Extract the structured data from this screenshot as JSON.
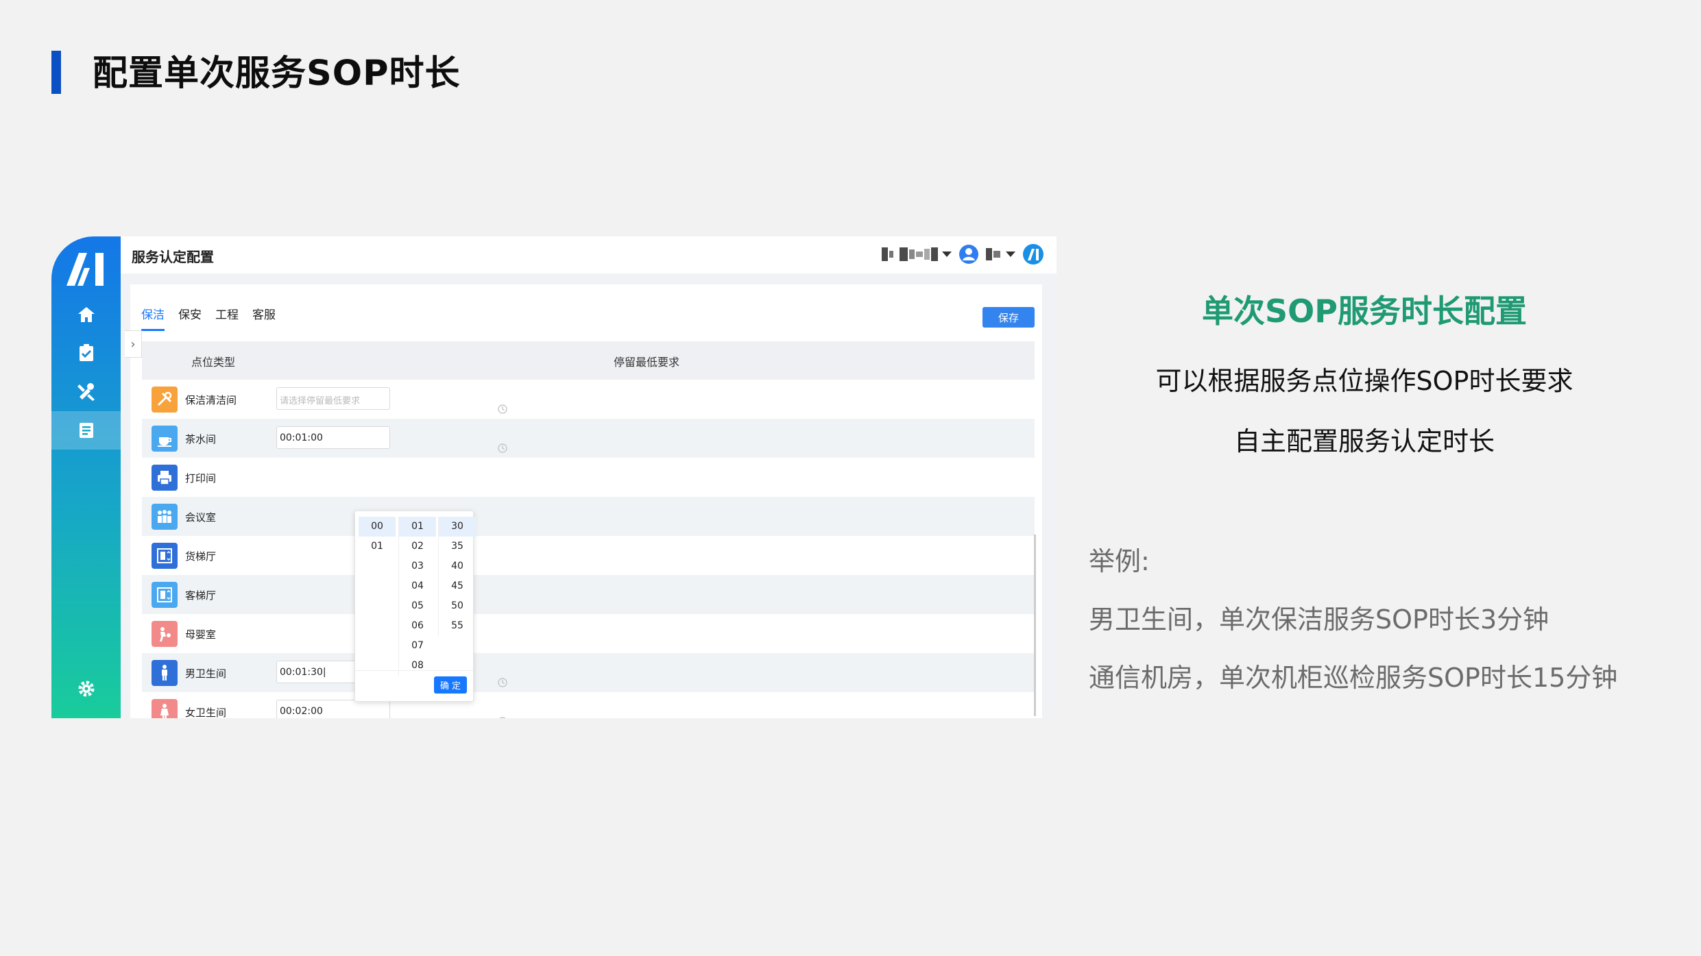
{
  "slide": {
    "title": "配置单次服务SOP时长",
    "accent_color": "#0b4fc4"
  },
  "app": {
    "title": "服务认定配置",
    "sidebar": {
      "items": [
        {
          "icon": "home-icon",
          "active": false
        },
        {
          "icon": "task-check-icon",
          "active": false
        },
        {
          "icon": "tools-icon",
          "active": false
        },
        {
          "icon": "document-list-icon",
          "active": true
        }
      ],
      "bottom_icon": "gear-icon"
    },
    "tabs": [
      {
        "label": "保洁",
        "active": true
      },
      {
        "label": "保安",
        "active": false
      },
      {
        "label": "工程",
        "active": false
      },
      {
        "label": "客服",
        "active": false
      }
    ],
    "save_label": "保存",
    "table": {
      "headers": [
        "点位类型",
        "停留最低要求"
      ],
      "rows": [
        {
          "label": "保洁清洁间",
          "value": "",
          "placeholder": "请选择停留最低要求",
          "icon": "cleaning-tools-icon",
          "icon_color": "#f7a23b"
        },
        {
          "label": "茶水间",
          "value": "00:01:00",
          "icon": "cup-icon",
          "icon_color": "#4aa8f0"
        },
        {
          "label": "打印间",
          "value": "",
          "icon": "printer-icon",
          "icon_color": "#2f6fd8"
        },
        {
          "label": "会议室",
          "value": "",
          "icon": "meeting-icon",
          "icon_color": "#4aa8f0"
        },
        {
          "label": "货梯厅",
          "value": "",
          "icon": "elevator-icon",
          "icon_color": "#2f6fd8"
        },
        {
          "label": "客梯厅",
          "value": "",
          "icon": "elevator-icon",
          "icon_color": "#4aa8f0"
        },
        {
          "label": "母婴室",
          "value": "",
          "icon": "mother-baby-icon",
          "icon_color": "#f28a8a"
        },
        {
          "label": "男卫生间",
          "value": "00:01:30",
          "icon": "male-icon",
          "icon_color": "#2f6fd8"
        },
        {
          "label": "女卫生间",
          "value": "00:02:00",
          "icon": "female-icon",
          "icon_color": "#f28a8a"
        }
      ]
    },
    "time_picker": {
      "hours": [
        "00",
        "01"
      ],
      "minutes": [
        "01",
        "02",
        "03",
        "04",
        "05",
        "06",
        "07",
        "08"
      ],
      "seconds": [
        "30",
        "35",
        "40",
        "45",
        "50",
        "55"
      ],
      "selected": {
        "hour": "00",
        "minute": "01",
        "second": "30"
      },
      "confirm_label": "确 定"
    }
  },
  "right": {
    "title": "单次SOP服务时长配置",
    "title_color": "#1f9a73",
    "line1": "可以根据服务点位操作SOP时长要求",
    "line2": "自主配置服务认定时长",
    "example_label": "举例:",
    "example1": "男卫生间，单次保洁服务SOP时长3分钟",
    "example2": "通信机房，单次机柜巡检服务SOP时长15分钟"
  }
}
